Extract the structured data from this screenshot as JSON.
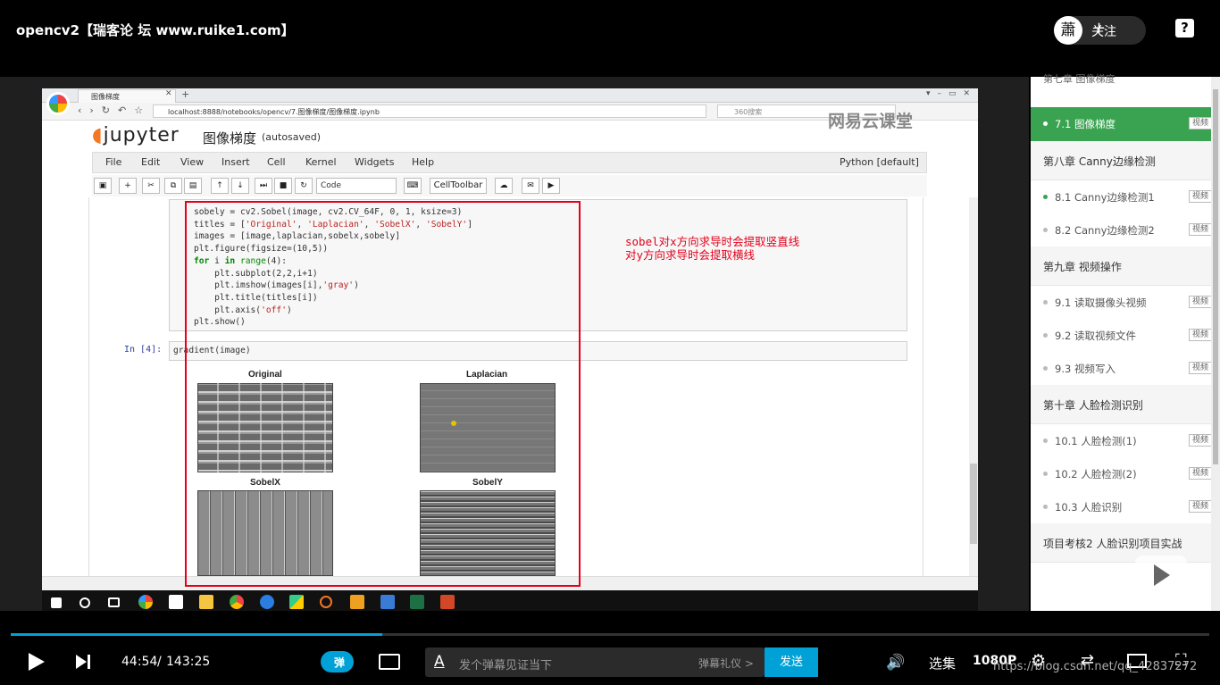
{
  "top": {
    "title": "opencv2【瑞客论 坛 www.ruike1.com】",
    "avatar_char": "蕭",
    "follow_label": "关注",
    "help_label": "?"
  },
  "browser": {
    "tab_title": "图像梯度",
    "address": "localhost:8888/notebooks/opencv/7.图像梯度/图像梯度.ipynb",
    "search_placeholder": "360搜索"
  },
  "jupyter": {
    "logo_text": "jupyter",
    "notebook_name": "图像梯度",
    "save_status": "(autosaved)",
    "menus": [
      "File",
      "Edit",
      "View",
      "Insert",
      "Cell",
      "Kernel",
      "Widgets",
      "Help"
    ],
    "kernel": "Python [default]",
    "cell_type": "Code",
    "celltoolbar_label": "CellToolbar",
    "code_lines": [
      "sobely = cv2.Sobel(image, cv2.CV_64F, 0, 1, ksize=3)",
      "titles = ['Original', 'Laplacian', 'SobelX', 'SobelY']",
      "images = [image,laplacian,sobelx,sobely]",
      "plt.figure(figsize=(10,5))",
      "for i in range(4):",
      "    plt.subplot(2,2,i+1)",
      "    plt.imshow(images[i],'gray')",
      "    plt.title(titles[i])",
      "    plt.axis('off')",
      "plt.show()"
    ],
    "prompt": "In  [4]:",
    "cell2_code": "gradient(image)",
    "plot_titles": [
      "Original",
      "Laplacian",
      "SobelX",
      "SobelY"
    ]
  },
  "watermark_logo": "网易云课堂",
  "annotation": {
    "line1": "sobel对x方向求导时会提取竖直线",
    "line2": "对y方向求导时会提取横线"
  },
  "sidebar": {
    "partial_chapter": "第七章 图像梯度",
    "items": [
      {
        "type": "item",
        "label": "7.1 图像梯度",
        "badge": "视频",
        "active": true
      },
      {
        "type": "chapter",
        "label": "第八章 Canny边缘检测"
      },
      {
        "type": "item",
        "label": "8.1 Canny边缘检测1",
        "badge": "视频",
        "dot_color": "#3aa351"
      },
      {
        "type": "item",
        "label": "8.2 Canny边缘检测2",
        "badge": "视频"
      },
      {
        "type": "chapter",
        "label": "第九章 视频操作"
      },
      {
        "type": "item",
        "label": "9.1 读取摄像头视频",
        "badge": "视频"
      },
      {
        "type": "item",
        "label": "9.2 读取视频文件",
        "badge": "视频"
      },
      {
        "type": "item",
        "label": "9.3 视频写入",
        "badge": "视频"
      },
      {
        "type": "chapter",
        "label": "第十章 人脸检测识别"
      },
      {
        "type": "item",
        "label": "10.1 人脸检测(1)",
        "badge": "视频"
      },
      {
        "type": "item",
        "label": "10.2 人脸检测(2)",
        "badge": "视频"
      },
      {
        "type": "item",
        "label": "10.3 人脸识别",
        "badge": "视频"
      },
      {
        "type": "chapter",
        "label": "项目考核2 人脸识别项目实战"
      }
    ]
  },
  "player": {
    "time_current": "44:54",
    "time_separator": "/",
    "time_total": "143:25",
    "progress": 0.31,
    "danmu_toggle": "弹",
    "danmu_placeholder": "发个弹幕见证当下",
    "danmu_etiquette": "弹幕礼仪 >",
    "send": "发送",
    "episodes": "选集",
    "quality": "1080P",
    "accent": "#00a1d6",
    "csdn_watermark": "https://blog.csdn.net/qq_42837272"
  },
  "colors": {
    "annotation_red": "#e3001b",
    "active_green": "#3aa351",
    "jupyter_orange": "#f37726"
  }
}
